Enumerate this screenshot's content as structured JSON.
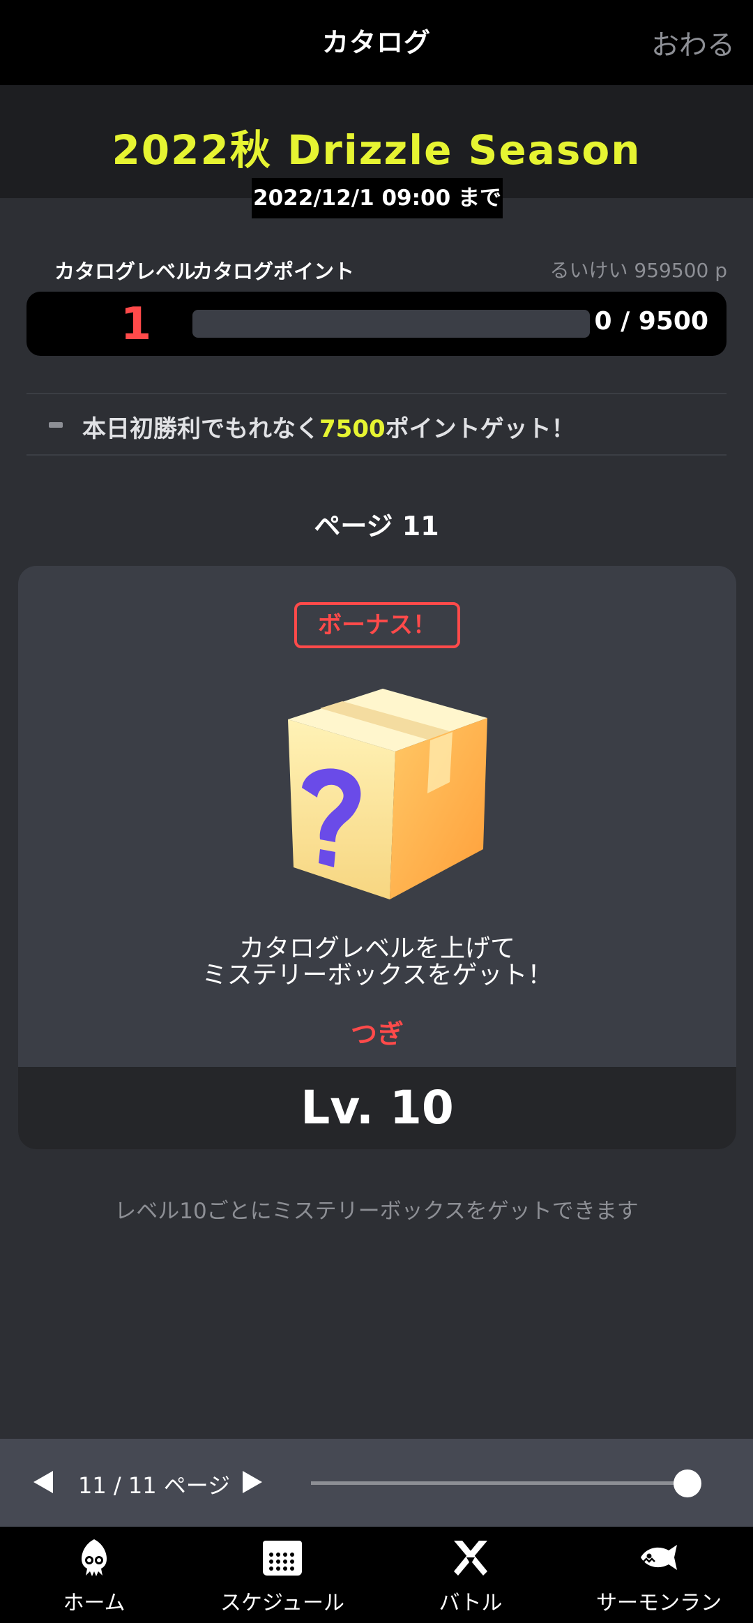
{
  "topbar": {
    "title": "カタログ",
    "close_label": "おわる"
  },
  "season": {
    "name": "2022秋 Drizzle Season",
    "deadline": "2022/12/1 09:00 まで"
  },
  "stats": {
    "level_label": "カタログレベル",
    "points_label": "カタログポイント",
    "total_label": "るいけい 959500 p",
    "level": "1",
    "points_value": "0 / 9500",
    "progress_fraction": 0.0
  },
  "mission": {
    "prefix": "本日初勝利でもれなく",
    "highlight": "7500",
    "suffix": "ポイントゲット！"
  },
  "page_title": "ページ 11",
  "card": {
    "bonus_label": "ボーナス！",
    "line1": "カタログレベルを上げて",
    "line2": "ミステリーボックスをゲット！",
    "next_label": "つぎ",
    "level_label": "Lv. 10",
    "icon": "mystery-box-icon"
  },
  "note": "レベル10ごとにミステリーボックスをゲットできます",
  "pager": {
    "page_info": "11 / 11 ページ",
    "slider_fraction": 1.0
  },
  "nav": [
    {
      "label": "ホーム",
      "icon": "squid-icon"
    },
    {
      "label": "スケジュール",
      "icon": "calendar-icon"
    },
    {
      "label": "バトル",
      "icon": "battle-icon"
    },
    {
      "label": "サーモンラン",
      "icon": "salmon-icon"
    }
  ],
  "colors": {
    "accent": "#e6f432",
    "alert": "#ff4a4a",
    "background": "#2d2f34"
  }
}
